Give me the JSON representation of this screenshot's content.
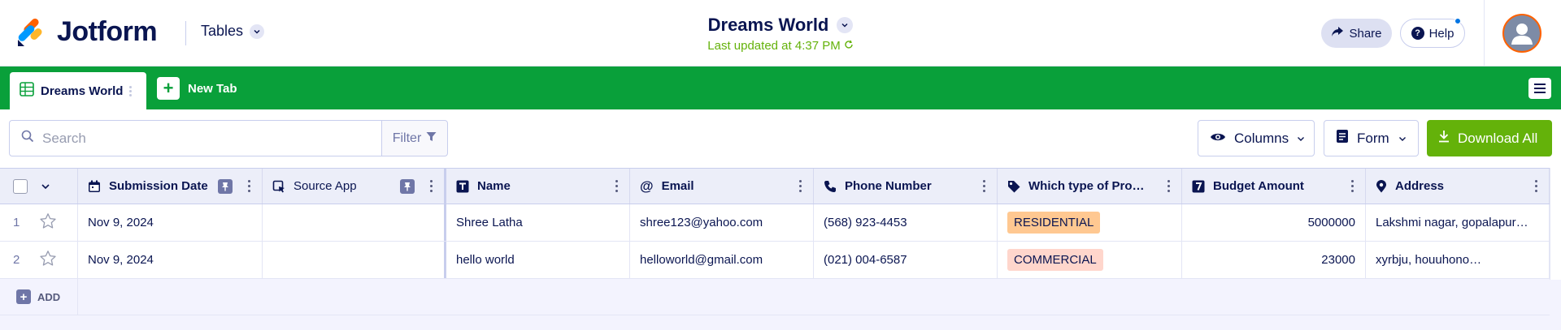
{
  "header": {
    "brand": "Jotform",
    "section_menu": "Tables",
    "title": "Dreams World",
    "last_updated": "Last updated at 4:37 PM",
    "share_label": "Share",
    "help_label": "Help"
  },
  "tabs": {
    "active_label": "Dreams World",
    "new_tab_label": "New Tab"
  },
  "toolbar": {
    "search_placeholder": "Search",
    "filter_label": "Filter",
    "columns_label": "Columns",
    "form_label": "Form",
    "download_label": "Download All"
  },
  "table": {
    "columns": [
      {
        "label": "Submission Date",
        "icon": "calendar-icon"
      },
      {
        "label": "Source App",
        "icon": "source-app-icon"
      },
      {
        "label": "Name",
        "icon": "text-type-icon"
      },
      {
        "label": "Email",
        "icon": "at-icon"
      },
      {
        "label": "Phone Number",
        "icon": "phone-icon"
      },
      {
        "label": "Which type of Pro…",
        "icon": "tag-icon"
      },
      {
        "label": "Budget Amount",
        "icon": "number-type-icon"
      },
      {
        "label": "Address",
        "icon": "location-pin-icon"
      }
    ],
    "rows": [
      {
        "num": "1",
        "submission_date": "Nov 9, 2024",
        "source_app": "",
        "name": "Shree Latha",
        "email": "shree123@yahoo.com",
        "phone": "(568) 923-4453",
        "property_type": "RESIDENTIAL",
        "budget": "5000000",
        "address": "Lakshmi nagar, gopalapur…"
      },
      {
        "num": "2",
        "submission_date": "Nov 9, 2024",
        "source_app": "",
        "name": "hello world",
        "email": "helloworld@gmail.com",
        "phone": "(021) 004-6587",
        "property_type": "COMMERCIAL",
        "budget": "23000",
        "address": "xyrbju, houuhono…"
      }
    ],
    "add_label": "ADD"
  },
  "colors": {
    "tabbar_green": "#09a03a",
    "download_green": "#64b20a",
    "navy": "#0a1551",
    "residential_tag": "#ffc891",
    "commercial_tag": "#ffd6cc",
    "avatar_ring": "#ff6100"
  }
}
